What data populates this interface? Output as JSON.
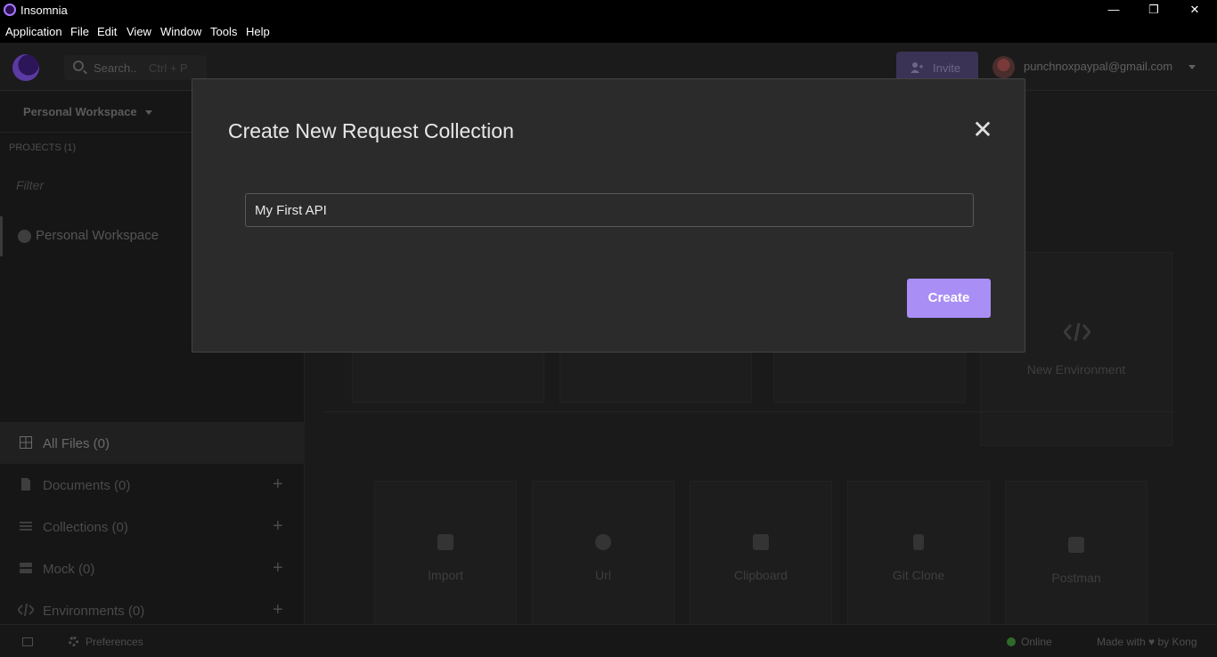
{
  "window": {
    "title": "Insomnia",
    "minimize": "—",
    "restore": "❐",
    "close": "✕"
  },
  "menu": [
    "Application",
    "File",
    "Edit",
    "View",
    "Window",
    "Tools",
    "Help"
  ],
  "topbar": {
    "search_label": "Search..",
    "search_shortcut": "Ctrl + P",
    "invite_label": "Invite",
    "account_email": "punchnoxpaypal@gmail.com"
  },
  "sidebar": {
    "workspace_name": "Personal Workspace",
    "projects_label": "PROJECTS (1)",
    "filter_placeholder": "Filter",
    "project_item": "Personal Workspace",
    "nav": [
      {
        "label": "All Files (0)",
        "icon": "grid-icon",
        "add": false
      },
      {
        "label": "Documents (0)",
        "icon": "document-icon",
        "add": true
      },
      {
        "label": "Collections (0)",
        "icon": "list-icon",
        "add": true
      },
      {
        "label": "Mock (0)",
        "icon": "server-icon",
        "add": true
      },
      {
        "label": "Environments (0)",
        "icon": "code-icon",
        "add": true
      }
    ],
    "plus": "+"
  },
  "main": {
    "new_environment_label": "New Environment",
    "import_tiles": [
      "Import",
      "Url",
      "Clipboard",
      "Git Clone",
      "Postman"
    ]
  },
  "footer": {
    "preferences_label": "Preferences",
    "status_label": "Online",
    "made_with_label": "Made with ♥ by Kong"
  },
  "modal": {
    "title": "Create New Request Collection",
    "close_icon": "✕",
    "name_value": "My First API",
    "create_label": "Create"
  },
  "colors": {
    "accent": "#a98ef5",
    "online": "#2e6b2a"
  }
}
